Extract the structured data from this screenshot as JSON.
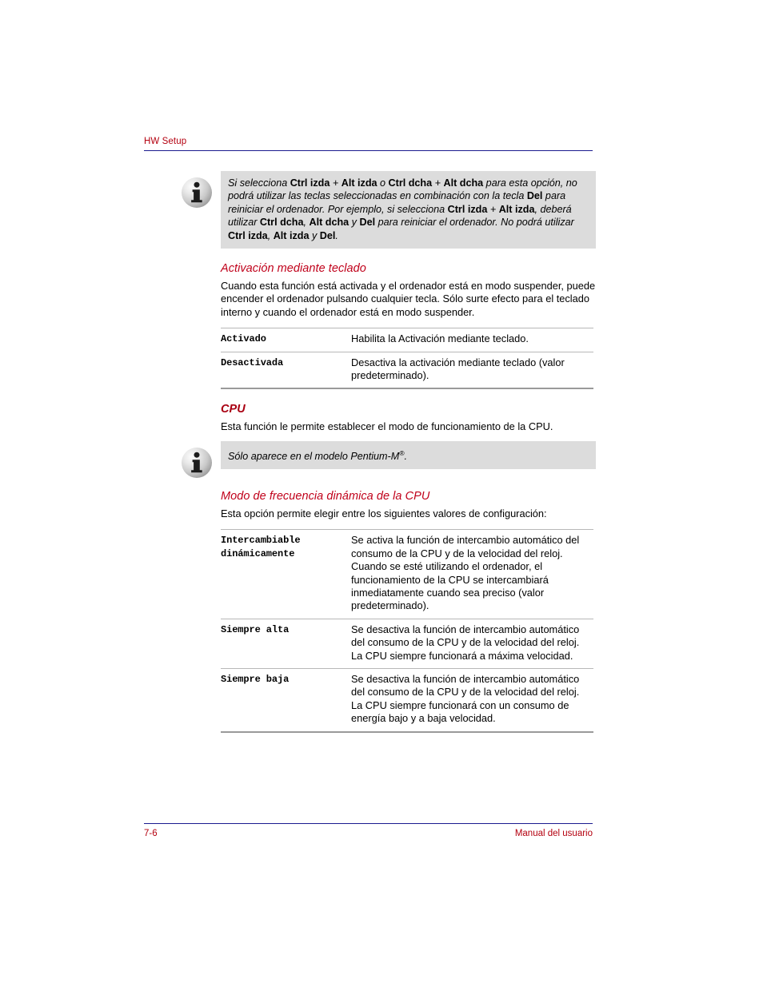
{
  "header": {
    "title": "HW Setup"
  },
  "notes": {
    "keyboard_note": {
      "icon": "info-icon",
      "segments": [
        {
          "text": "Si selecciona ",
          "bold": false
        },
        {
          "text": "Ctrl izda",
          "bold": true
        },
        {
          "text": " + ",
          "bold": false
        },
        {
          "text": "Alt izda",
          "bold": true
        },
        {
          "text": " o ",
          "bold": false
        },
        {
          "text": "Ctrl dcha",
          "bold": true
        },
        {
          "text": " + ",
          "bold": false
        },
        {
          "text": "Alt dcha",
          "bold": true
        },
        {
          "text": " para esta opción, no podrá utilizar las teclas seleccionadas en combinación con la tecla ",
          "bold": false
        },
        {
          "text": "Del",
          "bold": true
        },
        {
          "text": " para reiniciar el ordenador. Por ejemplo, si selecciona ",
          "bold": false
        },
        {
          "text": "Ctrl izda",
          "bold": true
        },
        {
          "text": " + ",
          "bold": false
        },
        {
          "text": "Alt izda",
          "bold": true
        },
        {
          "text": ", deberá utilizar ",
          "bold": false
        },
        {
          "text": "Ctrl dcha",
          "bold": true
        },
        {
          "text": ", ",
          "bold": false
        },
        {
          "text": "Alt dcha",
          "bold": true
        },
        {
          "text": " y ",
          "bold": false
        },
        {
          "text": "Del",
          "bold": true
        },
        {
          "text": " para reiniciar el ordenador. No podrá utilizar ",
          "bold": false
        },
        {
          "text": "Ctrl izda",
          "bold": true
        },
        {
          "text": ", ",
          "bold": false
        },
        {
          "text": "Alt izda",
          "bold": true
        },
        {
          "text": " y ",
          "bold": false
        },
        {
          "text": "Del",
          "bold": true
        },
        {
          "text": ".",
          "bold": false
        }
      ]
    },
    "cpu_note": {
      "icon": "info-icon",
      "text_before": "Sólo aparece en el modelo Pentium-M",
      "superscript": "®",
      "text_after": "."
    }
  },
  "sections": [
    {
      "heading": "Activación mediante teclado",
      "heading_style": "italic",
      "paragraph": "Cuando esta función está activada y el ordenador está en modo suspender, puede encender el ordenador pulsando cualquier tecla. Sólo surte efecto para el teclado interno y cuando el ordenador está en modo suspender."
    },
    {
      "heading": "CPU",
      "heading_style": "bold-italic",
      "paragraph": "Esta función le permite establecer el modo de funcionamiento de la CPU."
    },
    {
      "heading": "Modo de frecuencia dinámica de la CPU",
      "heading_style": "italic",
      "paragraph": "Esta opción permite elegir entre los siguientes valores de configuración:"
    }
  ],
  "tables": {
    "keyboard_wakeup": {
      "rows": [
        {
          "term": "Activado",
          "desc": "Habilita la Activación mediante teclado."
        },
        {
          "term": "Desactivada",
          "desc": "Desactiva la activación mediante teclado (valor predeterminado)."
        }
      ]
    },
    "cpu_frequency": {
      "rows": [
        {
          "term": "Intercambiable dinámicamente",
          "desc": "Se activa la función de intercambio automático del consumo de la CPU y de la velocidad del reloj. Cuando se esté utilizando el ordenador, el funcionamiento de la CPU se intercambiará inmediatamente cuando sea preciso (valor predeterminado)."
        },
        {
          "term": "Siempre alta",
          "desc": "Se desactiva la función de intercambio automático del consumo de la CPU y de la velocidad del reloj. La CPU siempre funcionará a máxima velocidad."
        },
        {
          "term": "Siempre baja",
          "desc": "Se desactiva la función de intercambio automático del consumo de la CPU y de la velocidad del reloj. La CPU siempre funcionará con un consumo de energía bajo y a baja velocidad."
        }
      ]
    }
  },
  "footer": {
    "page_number": "7-6",
    "manual_label": "Manual del usuario"
  },
  "colors": {
    "heading_red": "#c0001a",
    "heading_red_strong": "#a90012",
    "running_head_red": "#b4000f",
    "rule_blue": "#1b1b8f",
    "note_bg": "#dcdcdc",
    "table_rule": "#b8b8b8"
  }
}
